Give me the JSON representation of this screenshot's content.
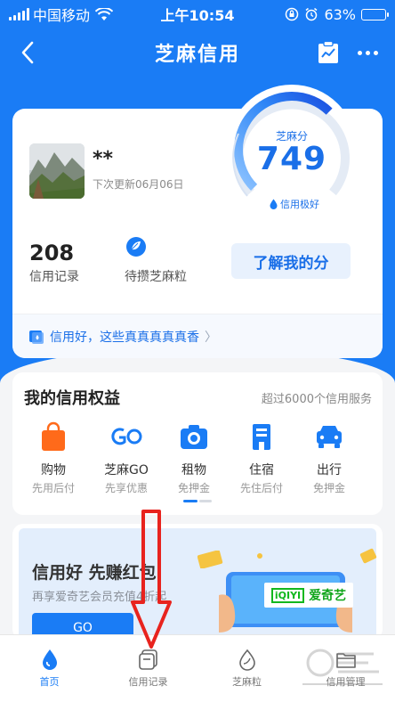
{
  "status_bar": {
    "carrier": "中国移动",
    "time": "上午10:54",
    "battery": "63%",
    "battery_level": 0.63
  },
  "nav": {
    "title": "芝麻信用"
  },
  "profile": {
    "name": "**",
    "update_text": "下次更新06月06日"
  },
  "score": {
    "label": "芝麻分",
    "value": "749",
    "grade": "信用极好"
  },
  "stats": {
    "records_count": "208",
    "records_label": "信用记录",
    "grain_label": "待攒芝麻粒"
  },
  "learn_button": "了解我的分",
  "banner_text": "信用好，这些真真真真真香",
  "benefits": {
    "title": "我的信用权益",
    "more": "超过6000个信用服务",
    "items": [
      {
        "name": "购物",
        "sub": "先用后付",
        "icon": "shopping-bag-icon"
      },
      {
        "name": "芝麻GO",
        "sub": "先享优惠",
        "icon": "go-logo-icon"
      },
      {
        "name": "租物",
        "sub": "免押金",
        "icon": "camera-icon"
      },
      {
        "name": "住宿",
        "sub": "先住后付",
        "icon": "hotel-icon"
      },
      {
        "name": "出行",
        "sub": "免押金",
        "icon": "car-icon"
      }
    ]
  },
  "promo": {
    "title": "信用好 先赚红包",
    "subtitle": "再享爱奇艺会员充值4折起",
    "button": "GO",
    "brand": "爱奇艺",
    "brand_mark": "iQIYI"
  },
  "tabbar": {
    "tabs": [
      {
        "label": "首页",
        "icon": "home-drop-icon",
        "active": true
      },
      {
        "label": "信用记录",
        "icon": "record-icon",
        "active": false
      },
      {
        "label": "芝麻粒",
        "icon": "grain-icon",
        "active": false
      },
      {
        "label": "信用管理",
        "icon": "manage-icon",
        "active": false
      }
    ]
  },
  "colors": {
    "primary": "#1a7cf5",
    "accent_orange": "#ff6a1a",
    "annotation_red": "#e8231e"
  }
}
